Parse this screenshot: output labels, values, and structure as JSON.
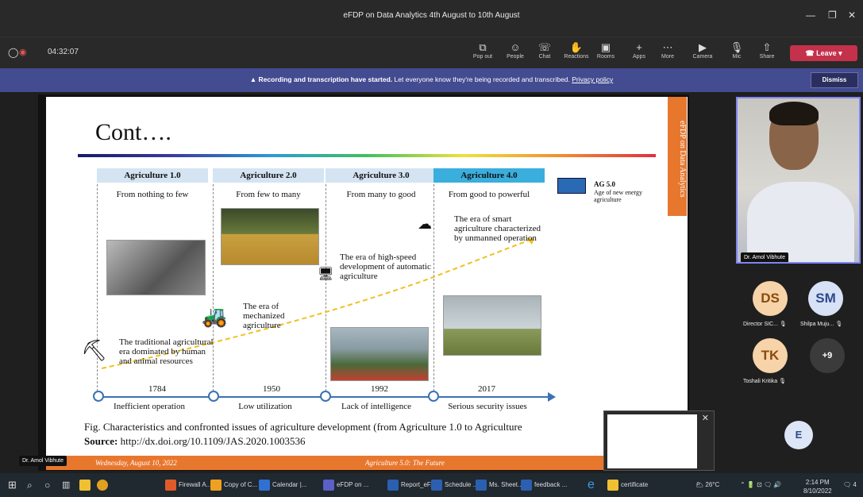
{
  "window": {
    "title": "eFDP on Data Analytics 4th August to 10th August"
  },
  "meeting": {
    "timer": "04:32:07",
    "toolbar": [
      {
        "icon": "pop-out-icon",
        "label": "Pop out"
      },
      {
        "icon": "people-icon",
        "label": "People"
      },
      {
        "icon": "chat-icon",
        "label": "Chat"
      },
      {
        "icon": "reactions-icon",
        "label": "Reactions"
      },
      {
        "icon": "rooms-icon",
        "label": "Rooms"
      },
      {
        "icon": "apps-icon",
        "label": "Apps"
      },
      {
        "icon": "more-icon",
        "label": "More"
      },
      {
        "icon": "camera-icon",
        "label": "Camera"
      },
      {
        "icon": "mic-icon",
        "label": "Mic"
      },
      {
        "icon": "share-icon",
        "label": "Share"
      }
    ],
    "leave_label": "Leave"
  },
  "banner": {
    "bold": "Recording and transcription have started.",
    "text": "Let everyone know they're being recorded and transcribed.",
    "link": "Privacy policy",
    "dismiss": "Dismiss"
  },
  "slide": {
    "title": "Cont….",
    "side_tab": "eFDP on Data Analytics",
    "columns": [
      {
        "header": "Agriculture 1.0",
        "sub": "From nothing to few",
        "year": "1784",
        "issue": "Inefficient operation"
      },
      {
        "header": "Agriculture 2.0",
        "sub": "From few to many",
        "year": "1950",
        "issue": "Low utilization"
      },
      {
        "header": "Agriculture 3.0",
        "sub": "From many to good",
        "year": "1992",
        "issue": "Lack of intelligence"
      },
      {
        "header": "Agriculture 4.0",
        "sub": "From good to powerful",
        "year": "2017",
        "issue": "Serious security issues"
      }
    ],
    "ag5_title": "AG 5.0",
    "ag5_desc": "Age of new energy agriculture",
    "eras": [
      "The traditional agricultural era dominated by human and animal resources",
      "The era of mechanized agriculture",
      "The era of high-speed development of automatic agriculture",
      "The era of smart agriculture characterized by unmanned operation"
    ],
    "fig_caption": "Fig. Characteristics and confronted issues of agriculture development (from Agriculture 1.0 to Agriculture",
    "source_label": "Source:",
    "source_url": "http://dx.doi.org/10.1109/JAS.2020.1003536",
    "footer_date": "Wednesday, August 10, 2022",
    "footer_center": "Agriculture 5.0: The Future"
  },
  "presenter_label": "Dr. Amol Vibhute",
  "video": {
    "name": "Dr. Amol Vibhute"
  },
  "participants": [
    {
      "initials": "DS",
      "name": "Director SIC...",
      "bg": "#f6d3a9",
      "fg": "#8a4b0c"
    },
    {
      "initials": "SM",
      "name": "Shilpa Muju...",
      "bg": "#d8e2f6",
      "fg": "#2b4a8a"
    },
    {
      "initials": "TK",
      "name": "Toshali Kritika",
      "bg": "#f6d3a9",
      "fg": "#8a4b0c"
    },
    {
      "initials": "+9",
      "name": "",
      "bg": "#3b3b3b",
      "fg": "#ffffff"
    }
  ],
  "self_avatar": "E",
  "taskbar": {
    "items": [
      "Firewall A...",
      "Copy of C...",
      "Calendar |...",
      "eFDP on ...",
      "Report_eF...",
      "Schedule ...",
      "Ms. Sheet...",
      "feedback ...",
      "certificate"
    ],
    "temperature": "26°C",
    "time": "2:14 PM",
    "date": "8/10/2022",
    "notifications": "4"
  }
}
